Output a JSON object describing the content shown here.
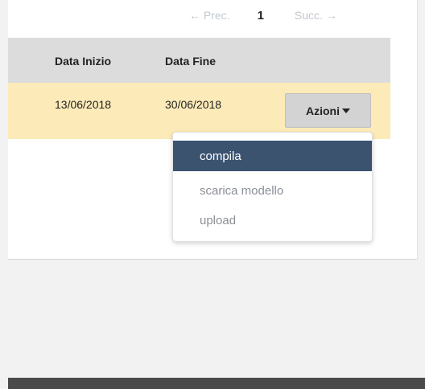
{
  "pagination": {
    "prev_label": "← Prec.",
    "current_page": "1",
    "next_label": "Succ. →"
  },
  "table": {
    "headers": [
      "Data Inizio",
      "Data Fine"
    ],
    "rows": [
      {
        "start_date": "13/06/2018",
        "end_date": "30/06/2018",
        "action_label": "Azioni"
      }
    ]
  },
  "dropdown": {
    "items": [
      {
        "label": "compila"
      },
      {
        "label": "scarica modello"
      },
      {
        "label": "upload"
      }
    ]
  },
  "colors": {
    "row_highlight": "#fcebb8",
    "header_bg": "#dcdcdc",
    "active_item": "#3c5370"
  }
}
